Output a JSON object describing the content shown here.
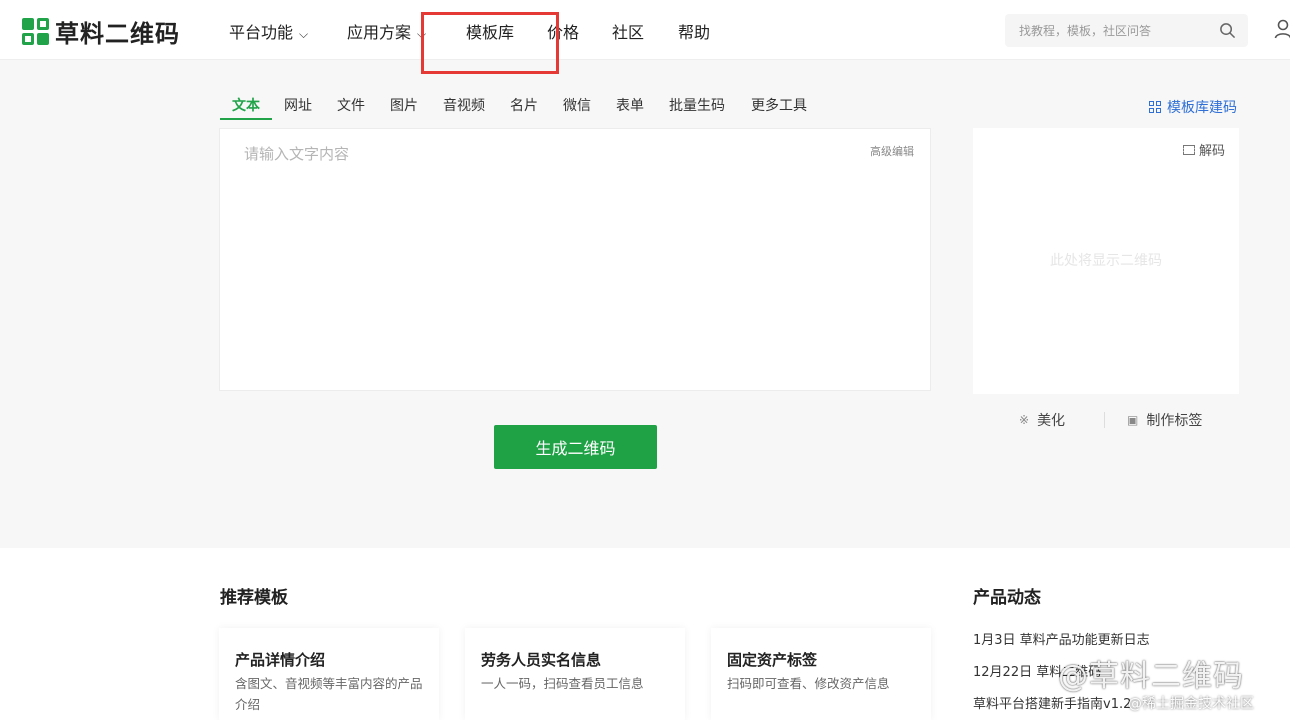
{
  "brand": {
    "name": "草料二维码",
    "color": "#21a34a"
  },
  "nav": {
    "items": [
      {
        "label": "平台功能",
        "dropdown": true
      },
      {
        "label": "应用方案",
        "dropdown": true
      },
      {
        "label": "模板库",
        "dropdown": false
      },
      {
        "label": "价格",
        "dropdown": false
      },
      {
        "label": "社区",
        "dropdown": false
      },
      {
        "label": "帮助",
        "dropdown": false
      }
    ],
    "highlighted": "模板库",
    "highlight_color": "#e53935"
  },
  "search": {
    "placeholder": "找教程，模板，社区问答"
  },
  "tabs": {
    "items": [
      "文本",
      "网址",
      "文件",
      "图片",
      "音视频",
      "名片",
      "微信",
      "表单",
      "批量生码",
      "更多工具"
    ],
    "active": "文本"
  },
  "template_link": "模板库建码",
  "editor": {
    "placeholder": "请输入文字内容",
    "advanced_label": "高级编辑"
  },
  "preview": {
    "decode_label": "解码",
    "hint": "此处将显示二维码"
  },
  "tools": {
    "beautify": "美化",
    "make_label": "制作标签"
  },
  "generate_button": "生成二维码",
  "recommended": {
    "title": "推荐模板",
    "cards": [
      {
        "title": "产品详情介绍",
        "desc": "含图文、音视频等丰富内容的产品介绍"
      },
      {
        "title": "劳务人员实名信息",
        "desc": "一人一码，扫码查看员工信息"
      },
      {
        "title": "固定资产标签",
        "desc": "扫码即可查看、修改资产信息"
      }
    ]
  },
  "news": {
    "title": "产品动态",
    "items": [
      "1月3日 草料产品功能更新日志",
      "12月22日 草料二维码",
      "草料平台搭建新手指南v1.2"
    ]
  },
  "watermark": {
    "main": "@草料二维码",
    "sub": "@稀土掘金技术社区"
  }
}
